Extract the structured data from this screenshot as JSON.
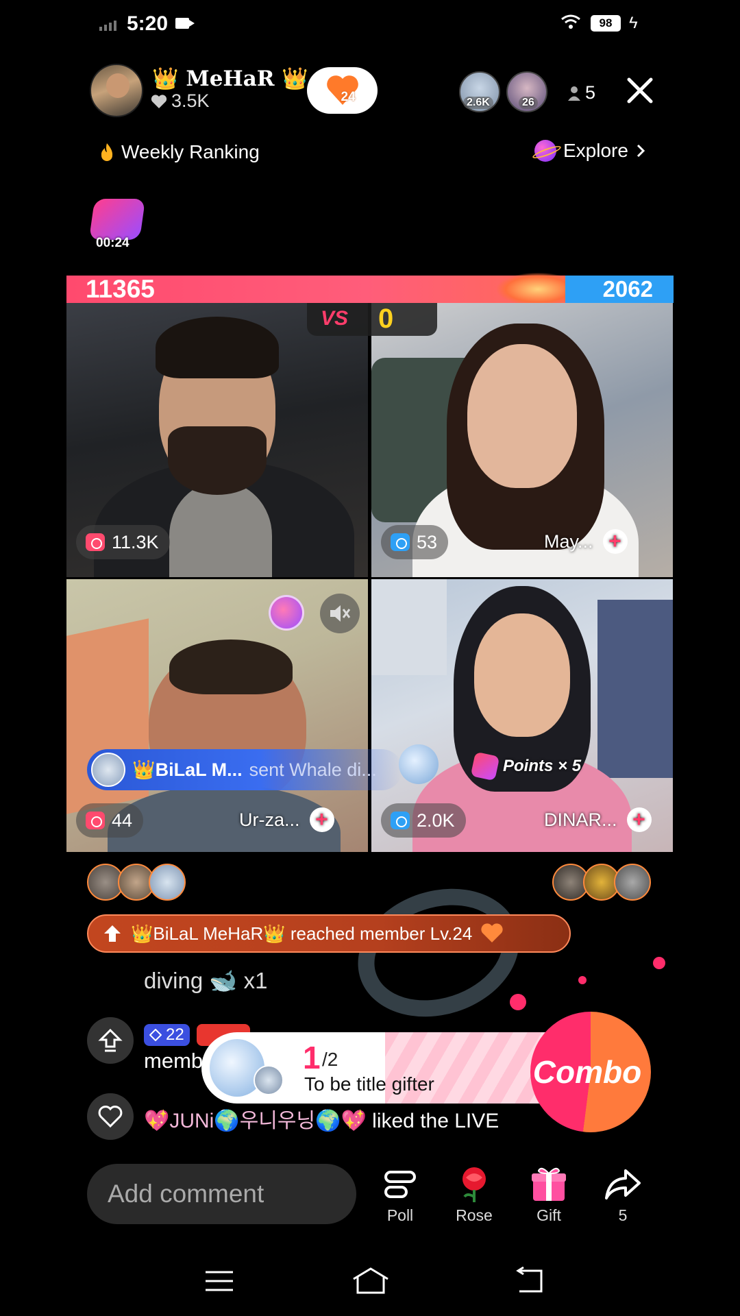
{
  "status_bar": {
    "time": "5:20",
    "battery": "98"
  },
  "host": {
    "name": "👑 MeHaR 👑",
    "likes": "3.5K",
    "fan_level": "24"
  },
  "viewers": [
    {
      "tag": "2.6K"
    },
    {
      "tag": "26"
    }
  ],
  "viewer_count": "5",
  "weekly_ranking": "Weekly Ranking",
  "explore": "Explore",
  "promo_timer": "00:24",
  "battle": {
    "score_left": "11365",
    "score_right": "2062",
    "vs_label": "VS",
    "points_left": "0"
  },
  "tiles": [
    {
      "count": "11.3K",
      "name": ""
    },
    {
      "count": "53",
      "name": "May..."
    },
    {
      "count": "44",
      "name": "Ur-za..."
    },
    {
      "count": "2.0K",
      "name": "DINAR..."
    }
  ],
  "gift_banner": {
    "sender": "👑BiLaL M...",
    "text": "sent Whale di..."
  },
  "points_tag": "Points × 5",
  "level_banner": "👑BiLaL MeHaR👑 reached member Lv.24",
  "chat": [
    {
      "text": "diving 🐋 x1"
    },
    {
      "badge_level": "22",
      "text": "memb"
    },
    {
      "user": "💖JUNi🌍우니우닝🌍💖",
      "text": "liked the LIVE"
    }
  ],
  "combo": {
    "count": "1",
    "total": "/2",
    "label": "To be title gifter",
    "button": "Combo"
  },
  "bottom_bar": {
    "comment_placeholder": "Add comment",
    "poll": "Poll",
    "rose": "Rose",
    "gift": "Gift",
    "share_count": "5"
  },
  "colors": {
    "team_red": "#ff4a6e",
    "team_blue": "#2ea0f5",
    "accent": "#ff2d6b"
  },
  "icons": [
    "signal-icon",
    "camera-icon",
    "wifi-icon",
    "battery-icon",
    "charging-icon",
    "heart-icon",
    "person-icon",
    "close-icon",
    "flame-icon",
    "planet-icon",
    "chevron-right-icon",
    "camera-badge-icon",
    "plus-icon",
    "mute-icon",
    "upload-arrow-icon",
    "diamond-icon",
    "poll-icon",
    "rose-icon",
    "gift-icon",
    "share-icon",
    "menu-icon",
    "home-icon",
    "back-icon"
  ]
}
